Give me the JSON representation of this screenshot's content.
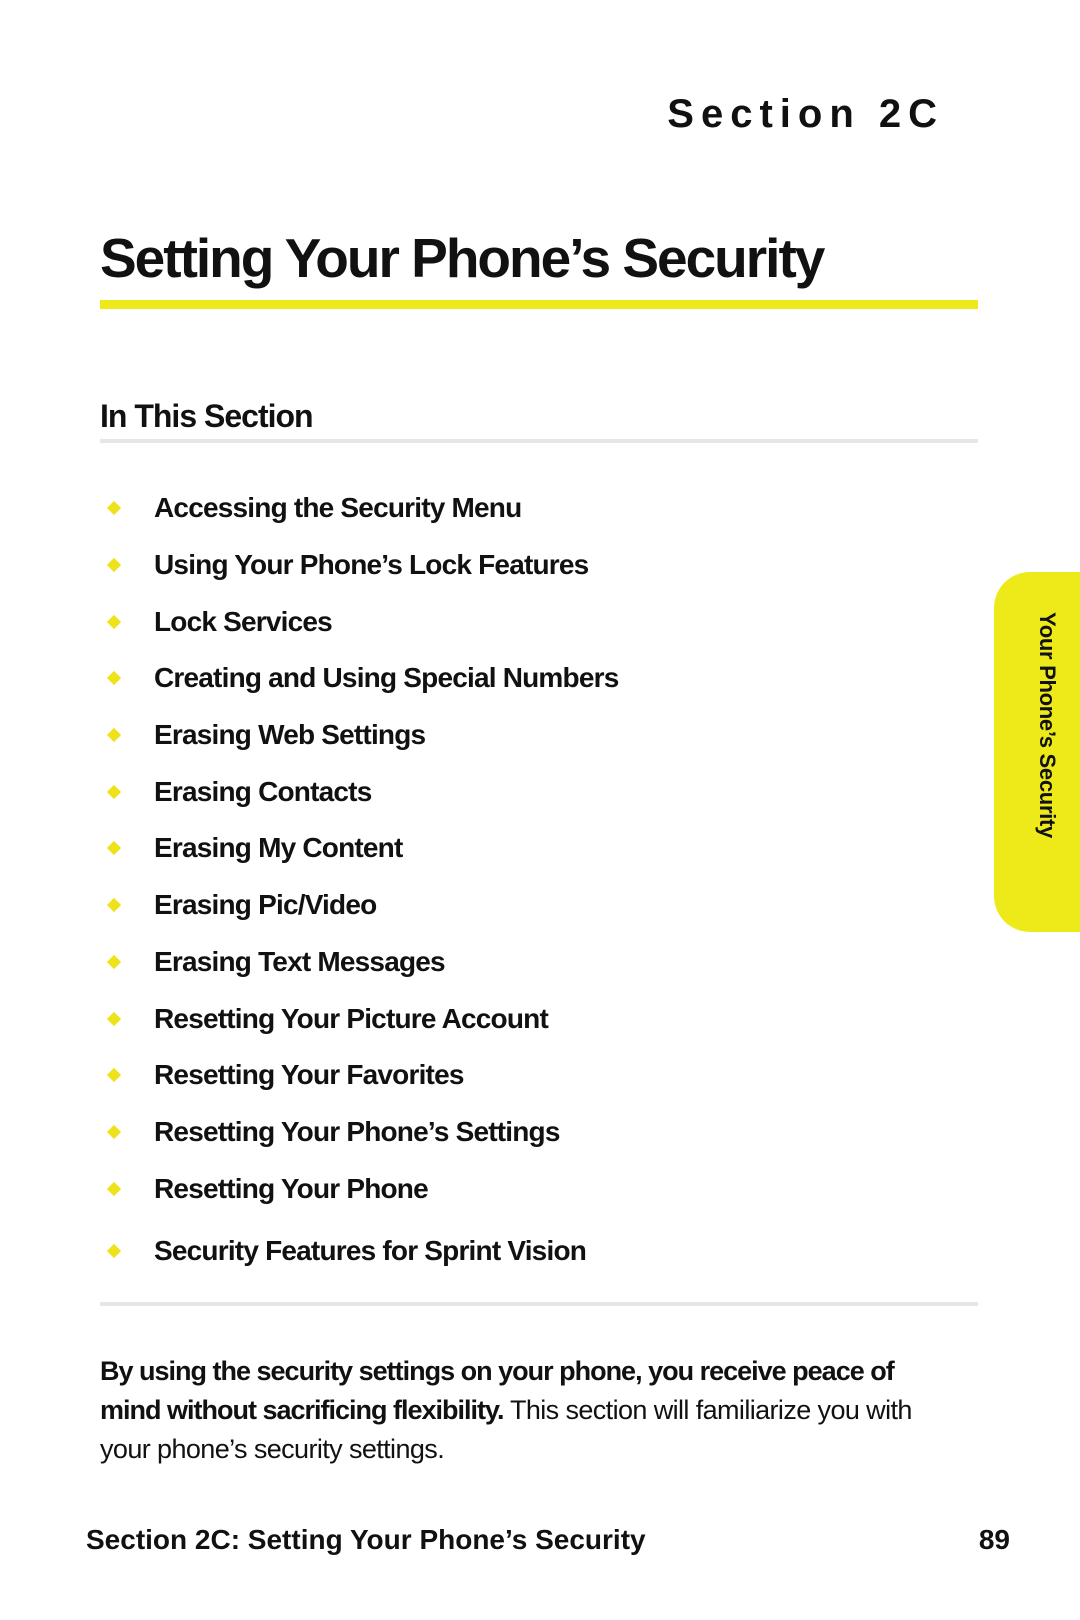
{
  "header": {
    "section_label": "Section 2C",
    "title": "Setting Your Phone’s Security"
  },
  "in_this_section": {
    "heading": "In This Section",
    "items": [
      {
        "label": "Accessing the Security Menu"
      },
      {
        "label": "Using Your Phone’s Lock Features"
      },
      {
        "label": "Lock Services"
      },
      {
        "label": "Creating and Using Special Numbers"
      },
      {
        "label": "Erasing Web Settings"
      },
      {
        "label": "Erasing Contacts"
      },
      {
        "label": "Erasing My Content"
      },
      {
        "label": "Erasing Pic/Video"
      },
      {
        "label": "Erasing Text Messages"
      },
      {
        "label": "Resetting Your Picture Account"
      },
      {
        "label": "Resetting Your Favorites"
      },
      {
        "label": "Resetting Your Phone’s Settings"
      },
      {
        "label": "Resetting Your Phone"
      },
      {
        "label": "Security Features for Sprint Vision"
      }
    ],
    "bullet_icon": "diamond-bullet"
  },
  "side_tab": {
    "label": "Your Phone’s Security"
  },
  "intro": {
    "bold": "By using the security settings on your phone, you receive peace of mind without sacrificing flexibility.",
    "regular": " This section will familiarize you with your phone’s security settings."
  },
  "footer": {
    "title": "Section 2C: Setting Your Phone’s Security",
    "page_number": "89"
  },
  "colors": {
    "accent_yellow": "#eeea1a",
    "rule_gray": "#e6e6e6",
    "text": "#111111"
  }
}
